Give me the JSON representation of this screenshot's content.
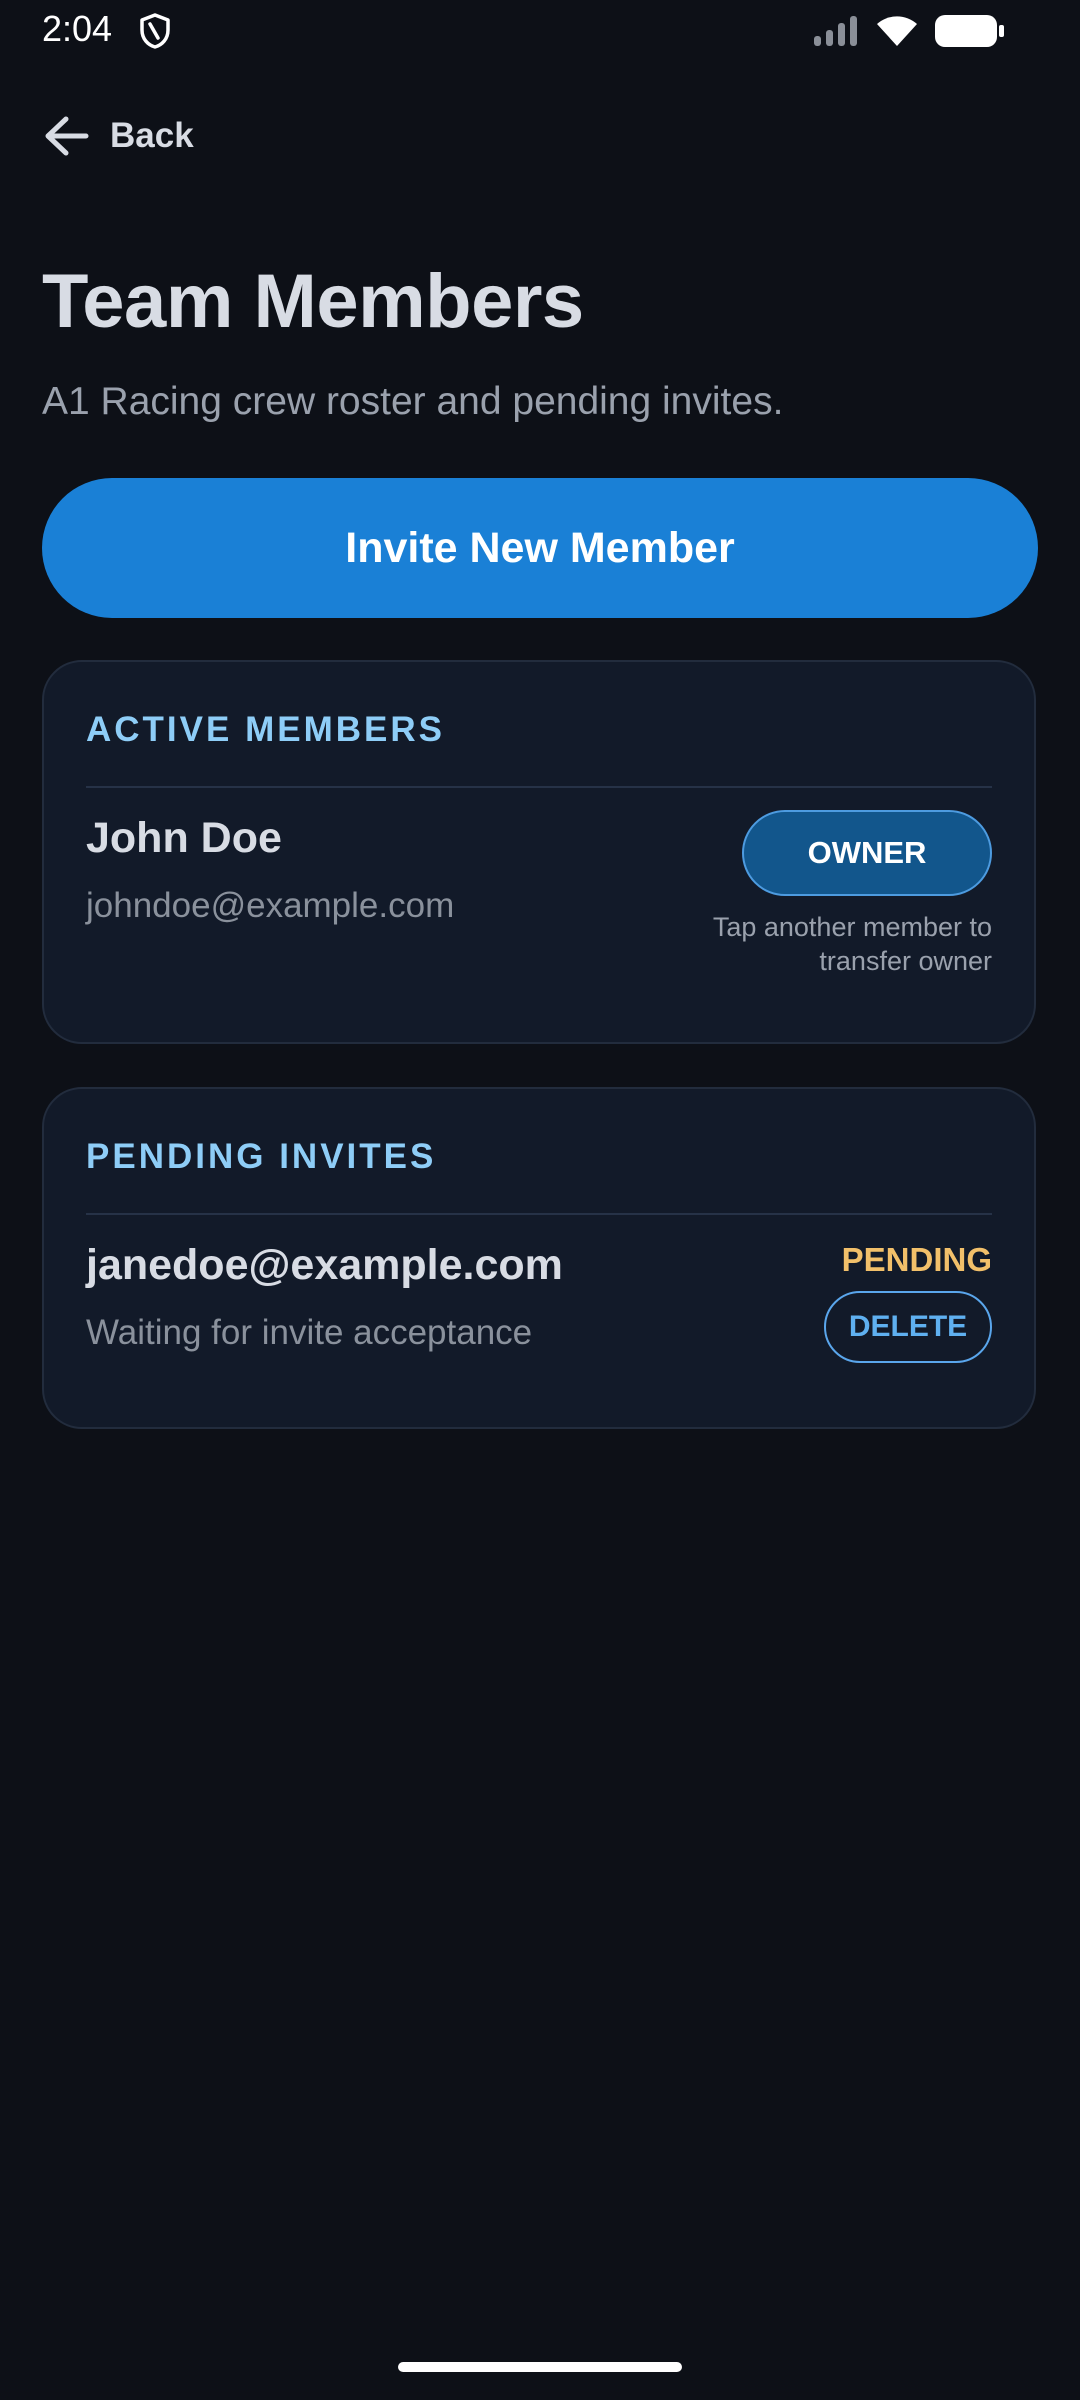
{
  "status_bar": {
    "time": "2:04",
    "icons": [
      "shield-icon",
      "signal-icon",
      "wifi-icon",
      "battery-icon"
    ]
  },
  "nav": {
    "back_label": "Back",
    "back_icon": "arrow-left-icon"
  },
  "header": {
    "title": "Team Members",
    "subtitle": "A1 Racing crew roster and pending invites."
  },
  "actions": {
    "invite_label": "Invite New Member"
  },
  "active_members": {
    "section_label": "ACTIVE MEMBERS",
    "members": [
      {
        "name": "John Doe",
        "email": "johndoe@example.com",
        "role_label": "OWNER",
        "hint": "Tap another member to transfer owner"
      }
    ]
  },
  "pending_invites": {
    "section_label": "PENDING INVITES",
    "invites": [
      {
        "email": "janedoe@example.com",
        "status_text": "Waiting for invite acceptance",
        "status_label": "PENDING",
        "delete_label": "DELETE"
      }
    ]
  },
  "colors": {
    "background": "#0d1017",
    "card": "#121a29",
    "accent": "#1a80d6",
    "section_label": "#8ecdf7",
    "pending": "#f2c06a"
  }
}
